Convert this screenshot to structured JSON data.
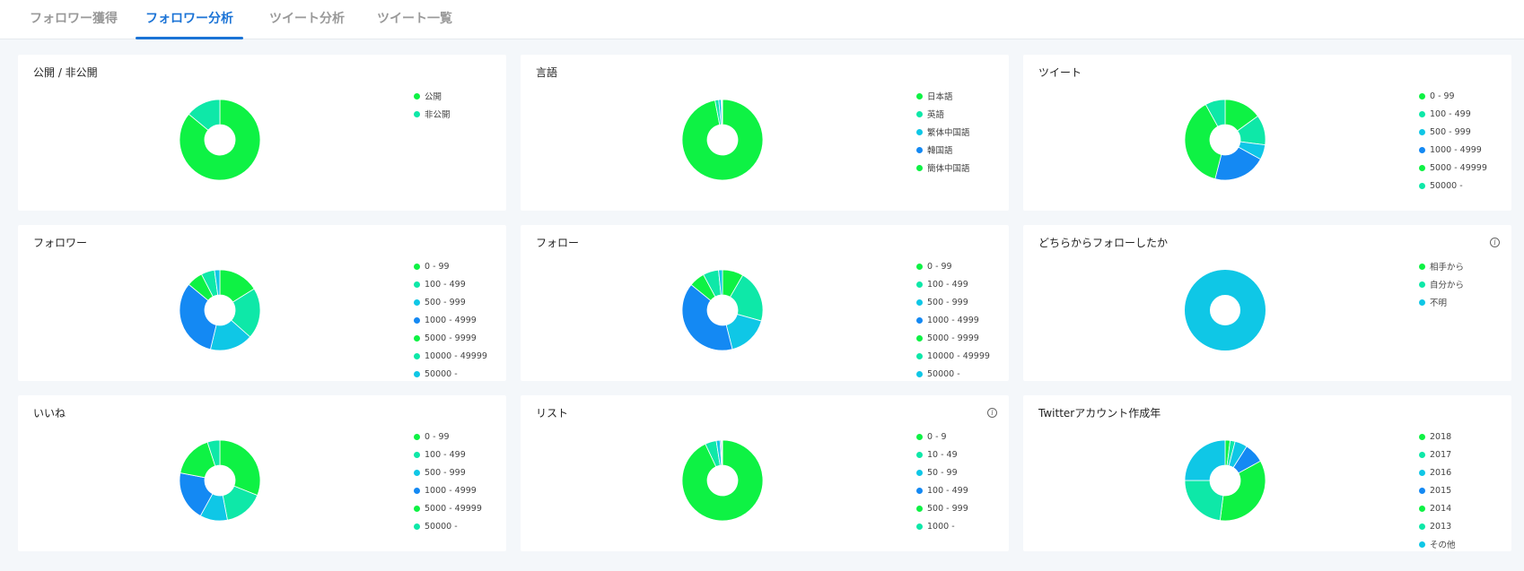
{
  "tabs": [
    {
      "label": "フォロワー獲得",
      "active": false
    },
    {
      "label": "フォロワー分析",
      "active": true
    },
    {
      "label": "ツイート分析",
      "active": false
    },
    {
      "label": "ツイート一覧",
      "active": false
    }
  ],
  "colors": [
    "#0ef244",
    "#0ee8a8",
    "#0fc7e6",
    "#1489f3"
  ],
  "chart_data": [
    {
      "type": "pie",
      "title": "公開 / 非公開",
      "info": false,
      "categories": [
        "公開",
        "非公開"
      ],
      "values": [
        86,
        14
      ],
      "colors": [
        "#0ef244",
        "#0ee8a8"
      ]
    },
    {
      "type": "pie",
      "title": "言語",
      "info": false,
      "categories": [
        "日本語",
        "英語",
        "繁体中国語",
        "韓国語",
        "簡体中国語"
      ],
      "values": [
        97,
        1.5,
        1,
        0.3,
        0.2
      ],
      "colors": [
        "#0ef244",
        "#0ee8a8",
        "#0fc7e6",
        "#1489f3",
        "#0ef244"
      ]
    },
    {
      "type": "pie",
      "title": "ツイート",
      "info": false,
      "categories": [
        "0 - 99",
        "100 - 499",
        "500 - 999",
        "1000 - 4999",
        "5000 - 49999",
        "50000 -"
      ],
      "values": [
        15,
        12,
        6,
        21,
        38,
        8
      ],
      "colors": [
        "#0ef244",
        "#0ee8a8",
        "#0fc7e6",
        "#1489f3",
        "#0ef244",
        "#0ee8a8"
      ]
    },
    {
      "type": "pie",
      "title": "フォロワー",
      "info": false,
      "categories": [
        "0 - 99",
        "100 - 499",
        "500 - 999",
        "1000 - 4999",
        "5000 - 9999",
        "10000 - 49999",
        "50000 -"
      ],
      "values": [
        15,
        19,
        16,
        30,
        6,
        5,
        2
      ],
      "colors": [
        "#0ef244",
        "#0ee8a8",
        "#0fc7e6",
        "#1489f3",
        "#0ef244",
        "#0ee8a8",
        "#0fc7e6"
      ]
    },
    {
      "type": "pie",
      "title": "フォロー",
      "info": false,
      "categories": [
        "0 - 99",
        "100 - 499",
        "500 - 999",
        "1000 - 4999",
        "5000 - 9999",
        "10000 - 49999",
        "50000 -"
      ],
      "values": [
        8,
        20,
        16,
        38,
        6,
        6,
        1.5
      ],
      "colors": [
        "#0ef244",
        "#0ee8a8",
        "#0fc7e6",
        "#1489f3",
        "#0ef244",
        "#0ee8a8",
        "#0fc7e6"
      ]
    },
    {
      "type": "pie",
      "title": "どちらからフォローしたか",
      "info": true,
      "categories": [
        "相手から",
        "自分から",
        "不明"
      ],
      "values": [
        0,
        0,
        100
      ],
      "colors": [
        "#0ef244",
        "#0ee8a8",
        "#0fc7e6"
      ]
    },
    {
      "type": "pie",
      "title": "いいね",
      "info": false,
      "categories": [
        "0 - 99",
        "100 - 499",
        "500 - 999",
        "1000 - 4999",
        "5000 - 49999",
        "50000 -"
      ],
      "values": [
        31,
        16,
        11,
        20,
        17,
        5
      ],
      "colors": [
        "#0ef244",
        "#0ee8a8",
        "#0fc7e6",
        "#1489f3",
        "#0ef244",
        "#0ee8a8"
      ]
    },
    {
      "type": "pie",
      "title": "リスト",
      "info": true,
      "categories": [
        "0 - 9",
        "10 - 49",
        "50 - 99",
        "100 - 499",
        "500 - 999",
        "1000 -"
      ],
      "values": [
        93,
        4.5,
        1.5,
        0.5,
        0.3,
        0.2
      ],
      "colors": [
        "#0ef244",
        "#0ee8a8",
        "#0fc7e6",
        "#1489f3",
        "#0ef244",
        "#0ee8a8"
      ]
    },
    {
      "type": "pie",
      "title": "Twitterアカウント作成年",
      "info": false,
      "categories": [
        "2018",
        "2017",
        "2016",
        "2015",
        "2014",
        "2013",
        "その他"
      ],
      "values": [
        2,
        2,
        5,
        8,
        35,
        23,
        25
      ],
      "colors": [
        "#0ef244",
        "#0ee8a8",
        "#0fc7e6",
        "#1489f3",
        "#0ef244",
        "#0ee8a8",
        "#0fc7e6"
      ]
    }
  ]
}
